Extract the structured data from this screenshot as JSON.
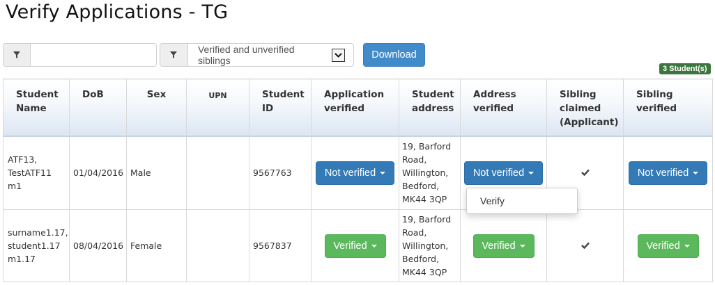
{
  "page": {
    "title": "Verify Applications - TG"
  },
  "filters": {
    "text_filter": {
      "value": "",
      "placeholder": ""
    },
    "sibling_filter": {
      "selected": "Verified and unverified siblings"
    },
    "download_label": "Download"
  },
  "student_count": "3 Student(s)",
  "table": {
    "headers": {
      "student_name": [
        "Student",
        "Name"
      ],
      "dob": "DoB",
      "sex": "Sex",
      "upn": "UPN",
      "student_id": [
        "Student",
        "ID"
      ],
      "app_verified": [
        "Application",
        "verified"
      ],
      "address": [
        "Student",
        "address"
      ],
      "addr_verified": [
        "Address",
        "verified"
      ],
      "sib_claimed": [
        "Sibling",
        "claimed",
        "(Applicant)"
      ],
      "sib_verified": [
        "Sibling",
        "verified"
      ]
    },
    "rows": [
      {
        "name": [
          "ATF13,",
          "TestATF11",
          "m1"
        ],
        "dob": "01/04/2016",
        "sex": "Male",
        "upn": "",
        "student_id": "9567763",
        "app_verified": "Not verified",
        "address": [
          "19, Barford",
          "Road,",
          "Willington,",
          "Bedford,",
          "MK44 3QP"
        ],
        "addr_verified": "Not verified",
        "sib_claimed_icon": "checkmark-icon",
        "sib_verified": "Not verified"
      },
      {
        "name": [
          "surname1.17,",
          "student1.17",
          "m1.17"
        ],
        "dob": "08/04/2016",
        "sex": "Female",
        "upn": "",
        "student_id": "9567837",
        "app_verified": "Verified",
        "address": [
          "19, Barford",
          "Road,",
          "Willington,",
          "Bedford,",
          "MK44 3QP"
        ],
        "addr_verified": "Verified",
        "sib_claimed_icon": "checkmark-icon",
        "sib_verified": "Verified"
      }
    ]
  },
  "dropdown": {
    "items": [
      "Verify"
    ]
  },
  "colors": {
    "primary": "#337ab7",
    "success": "#5cb85c",
    "badge": "#3c763d"
  }
}
